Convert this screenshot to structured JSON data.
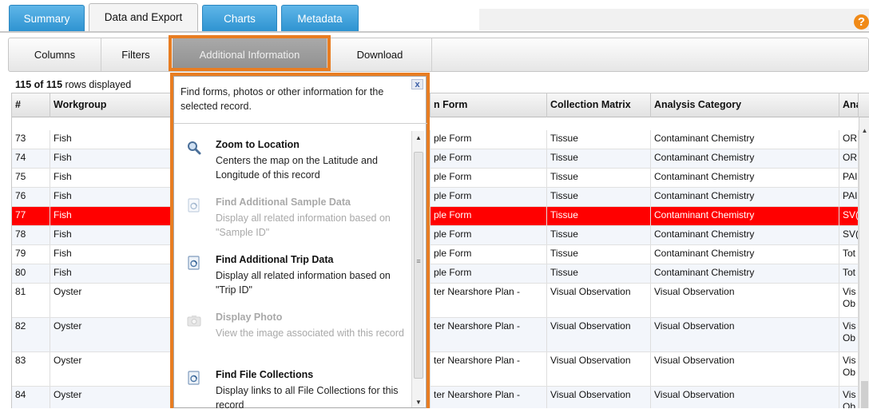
{
  "tabs": [
    {
      "label": "Summary"
    },
    {
      "label": "Data and Export"
    },
    {
      "label": "Charts"
    },
    {
      "label": "Metadata"
    }
  ],
  "help_icon": {
    "glyph": "?",
    "name": "help-icon"
  },
  "toolbar": {
    "columns": "Columns",
    "filters": "Filters",
    "additional_info": "Additional Information",
    "download": "Download"
  },
  "rowcount": {
    "shown": "115 of 115",
    "suffix": " rows displayed"
  },
  "columns": [
    "#",
    "Workgroup",
    "n Form",
    "Collection Matrix",
    "Analysis Category",
    "Ana"
  ],
  "rows": [
    {
      "num": "73",
      "workgroup": "Fish",
      "form": "ple Form",
      "matrix": "Tissue",
      "category": "Contaminant Chemistry",
      "ana": "OR"
    },
    {
      "num": "74",
      "workgroup": "Fish",
      "form": "ple Form",
      "matrix": "Tissue",
      "category": "Contaminant Chemistry",
      "ana": "OR"
    },
    {
      "num": "75",
      "workgroup": "Fish",
      "form": "ple Form",
      "matrix": "Tissue",
      "category": "Contaminant Chemistry",
      "ana": "PAI"
    },
    {
      "num": "76",
      "workgroup": "Fish",
      "form": "ple Form",
      "matrix": "Tissue",
      "category": "Contaminant Chemistry",
      "ana": "PAI"
    },
    {
      "num": "77",
      "workgroup": "Fish",
      "form": "ple Form",
      "matrix": "Tissue",
      "category": "Contaminant Chemistry",
      "ana": "SV("
    },
    {
      "num": "78",
      "workgroup": "Fish",
      "form": "ple Form",
      "matrix": "Tissue",
      "category": "Contaminant Chemistry",
      "ana": "SV("
    },
    {
      "num": "79",
      "workgroup": "Fish",
      "form": "ple Form",
      "matrix": "Tissue",
      "category": "Contaminant Chemistry",
      "ana": "Tot"
    },
    {
      "num": "80",
      "workgroup": "Fish",
      "form": "ple Form",
      "matrix": "Tissue",
      "category": "Contaminant Chemistry",
      "ana": "Tot"
    },
    {
      "num": "81",
      "workgroup": "Oyster",
      "form": "ter Nearshore Plan -",
      "matrix": "Visual Observation",
      "category": "Visual Observation",
      "ana": "Vis Ob"
    },
    {
      "num": "82",
      "workgroup": "Oyster",
      "form": "ter Nearshore Plan -",
      "matrix": "Visual Observation",
      "category": "Visual Observation",
      "ana": "Vis Ob"
    },
    {
      "num": "83",
      "workgroup": "Oyster",
      "form": "ter Nearshore Plan -",
      "matrix": "Visual Observation",
      "category": "Visual Observation",
      "ana": "Vis Ob"
    },
    {
      "num": "84",
      "workgroup": "Oyster",
      "form": "ter Nearshore Plan -",
      "matrix": "Visual Observation",
      "category": "Visual Observation",
      "ana": "Vis Ob"
    }
  ],
  "selected_row": "77",
  "colors": {
    "accent_orange": "#e87d22",
    "selected_row": "#ff0000",
    "tab_blue": "#2e93d1"
  },
  "popup": {
    "close": "x",
    "description": "Find forms, photos or other information for the selected record.",
    "items": [
      {
        "title": "Zoom to Location",
        "desc": "Centers the map on the Latitude and Longitude of this record",
        "icon": "magnifier-icon",
        "enabled": true
      },
      {
        "title": "Find Additional Sample Data",
        "desc": "Display all related information based on \"Sample ID\"",
        "icon": "document-icon",
        "enabled": false
      },
      {
        "title": "Find Additional Trip Data",
        "desc": "Display all related information based on \"Trip ID\"",
        "icon": "document-icon",
        "enabled": true
      },
      {
        "title": "Display Photo",
        "desc": "View the image associated with this record",
        "icon": "camera-icon",
        "enabled": false
      },
      {
        "title": "Find File Collections",
        "desc": "Display links to all File Collections for this record",
        "icon": "document-icon",
        "enabled": true
      }
    ]
  }
}
